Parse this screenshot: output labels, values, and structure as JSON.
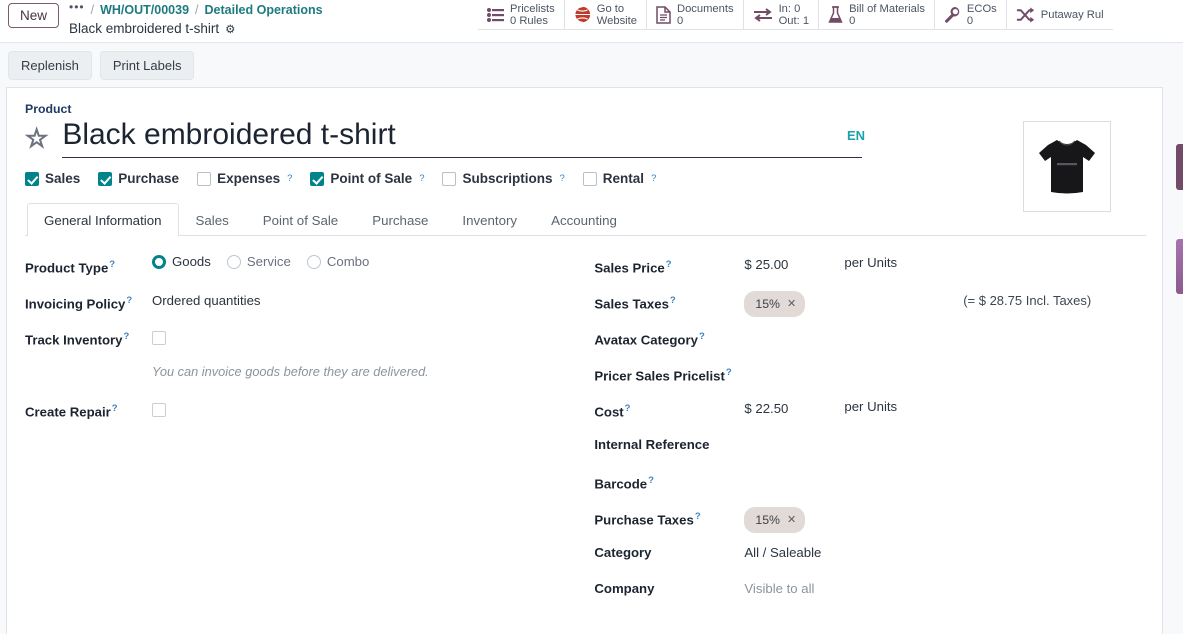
{
  "topbar": {
    "new_button": "New",
    "breadcrumb_overflow": "•••",
    "separator": "/",
    "crumb1": "WH/OUT/00039",
    "crumb2": "Detailed Operations",
    "record_name": "Black embroidered t-shirt",
    "settings_icon": "gear-icon"
  },
  "stat_buttons": [
    {
      "icon": "list-rules-icon",
      "line1": "Pricelists",
      "line2": "0 Rules"
    },
    {
      "icon": "globe-icon",
      "line1": "Go to",
      "line2": "Website"
    },
    {
      "icon": "document-icon",
      "line1": "Documents",
      "line2": "0"
    },
    {
      "icon": "arrows-in-out-icon",
      "line1": "In: 0",
      "line2": "Out: 1"
    },
    {
      "icon": "flask-icon",
      "line1": "Bill of Materials",
      "line2": "0"
    },
    {
      "icon": "wrench-icon",
      "line1": "ECOs",
      "line2": "0"
    },
    {
      "icon": "shuffle-icon",
      "line1": "Putaway Rul",
      "line2": ""
    }
  ],
  "action_buttons": [
    {
      "label": "Replenish"
    },
    {
      "label": "Print Labels"
    }
  ],
  "form": {
    "product_label": "Product",
    "product_name": "Black embroidered t-shirt",
    "language_badge": "EN",
    "star_icon": "favorite-star-icon",
    "product_image_alt": "black-tshirt-image"
  },
  "app_checkboxes": [
    {
      "label": "Sales",
      "checked": true,
      "help": false
    },
    {
      "label": "Purchase",
      "checked": true,
      "help": false
    },
    {
      "label": "Expenses",
      "checked": false,
      "help": true
    },
    {
      "label": "Point of Sale",
      "checked": true,
      "help": true
    },
    {
      "label": "Subscriptions",
      "checked": false,
      "help": true
    },
    {
      "label": "Rental",
      "checked": false,
      "help": true
    }
  ],
  "tabs": [
    {
      "label": "General Information",
      "active": true
    },
    {
      "label": "Sales",
      "active": false
    },
    {
      "label": "Point of Sale",
      "active": false
    },
    {
      "label": "Purchase",
      "active": false
    },
    {
      "label": "Inventory",
      "active": false
    },
    {
      "label": "Accounting",
      "active": false
    }
  ],
  "left_fields": {
    "product_type_label": "Product Type",
    "product_type_options": [
      {
        "label": "Goods",
        "selected": true
      },
      {
        "label": "Service",
        "selected": false
      },
      {
        "label": "Combo",
        "selected": false
      }
    ],
    "invoicing_policy_label": "Invoicing Policy",
    "invoicing_policy_value": "Ordered quantities",
    "track_inventory_label": "Track Inventory",
    "track_inventory_checked": false,
    "hint": "You can invoice goods before they are delivered.",
    "create_repair_label": "Create Repair",
    "create_repair_checked": false
  },
  "right_fields": {
    "sales_price_label": "Sales Price",
    "sales_price_value": "$ 25.00",
    "sales_price_uom": "per Units",
    "sales_taxes_label": "Sales Taxes",
    "sales_taxes_tag": "15%",
    "sales_taxes_incl": "(= $ 28.75 Incl. Taxes)",
    "avatax_category_label": "Avatax Category",
    "avatax_category_value": "",
    "pricer_pricelist_label": "Pricer Sales Pricelist",
    "pricer_pricelist_value": "",
    "cost_label": "Cost",
    "cost_value": "$ 22.50",
    "cost_uom": "per Units",
    "internal_reference_label": "Internal Reference",
    "internal_reference_value": "",
    "barcode_label": "Barcode",
    "barcode_value": "",
    "purchase_taxes_label": "Purchase Taxes",
    "purchase_taxes_tag": "15%",
    "category_label": "Category",
    "category_value": "All / Saleable",
    "company_label": "Company",
    "company_value": "Visible to all"
  },
  "colors": {
    "brand_purple": "#714B67",
    "teal_link": "#1d7b80",
    "teal_accent": "#00848c",
    "blue_help": "#3b82c4",
    "tag_bg": "#e2dad6",
    "globe_red": "#c0392b"
  }
}
